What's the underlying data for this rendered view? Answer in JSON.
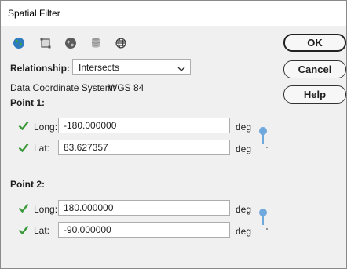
{
  "window": {
    "title": "Spatial Filter"
  },
  "toolbar": {
    "icons": [
      "globe-icon",
      "rectangle-icon",
      "world-icon",
      "database-icon",
      "web-icon"
    ]
  },
  "relationship": {
    "label": "Relationship:",
    "value": "Intersects"
  },
  "coordinate_system": {
    "label": "Data Coordinate System:",
    "value": "WGS 84"
  },
  "point1": {
    "label": "Point 1:",
    "long": {
      "label": "Long:",
      "value": "-180.000000",
      "unit": "deg"
    },
    "lat": {
      "label": "Lat:",
      "value": "83.627357",
      "unit": "deg"
    }
  },
  "point2": {
    "label": "Point 2:",
    "long": {
      "label": "Long:",
      "value": "180.000000",
      "unit": "deg"
    },
    "lat": {
      "label": "Lat:",
      "value": "-90.000000",
      "unit": "deg"
    }
  },
  "buttons": {
    "ok": "OK",
    "cancel": "Cancel",
    "help": "Help"
  },
  "colors": {
    "check": "#3a9a3a",
    "pin": "#6fa8dc",
    "accent_globe": "#2e7bbf"
  }
}
